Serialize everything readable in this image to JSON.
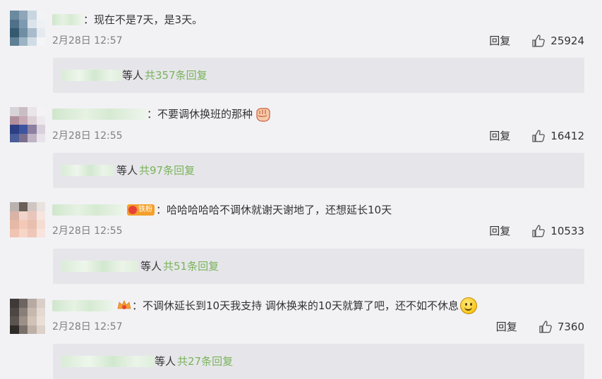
{
  "comments": [
    {
      "content": "：现在不是7天，是3天。",
      "timestamp": "2月28日 12:57",
      "reply_label": "回复",
      "likes": "25924",
      "replies_suffix": "等人",
      "replies_link": "共357条回复",
      "avatar_colors": [
        "#6b8aa0",
        "#8fa6b8",
        "#c9d6e0",
        "#f1f3f5",
        "#4e7088",
        "#7d9bb0",
        "#dbe4ea",
        "#eef1f4",
        "#35596f",
        "#6f8ea3",
        "#a9bccb",
        "#e4eaef",
        "#5f7f95",
        "#9cb3c3",
        "#d0dce5",
        "#f3f5f7"
      ]
    },
    {
      "content": "：不要调休换班的那种",
      "timestamp": "2月28日 12:55",
      "reply_label": "回复",
      "likes": "16412",
      "replies_suffix": "等人",
      "replies_link": "共97条回复",
      "avatar_colors": [
        "#d8d2d9",
        "#c9bec4",
        "#e9e5ea",
        "#f4f2f5",
        "#b08f9c",
        "#c7a9b5",
        "#dccfd6",
        "#eee9ec",
        "#2c3f82",
        "#3d54a0",
        "#8c7fa0",
        "#d9d0dc",
        "#4a5d9a",
        "#7c6f8e",
        "#bfb3c4",
        "#e8e3ea"
      ],
      "emoji": "fist-icon"
    },
    {
      "content": "：哈哈哈哈哈不调休就谢天谢地了，还想延长10天",
      "timestamp": "2月28日 12:55",
      "reply_label": "回复",
      "likes": "10533",
      "replies_suffix": "等人",
      "replies_link": "共51条回复",
      "badge_text": "铁粉",
      "avatar_colors": [
        "#b9b2ae",
        "#6b5f5a",
        "#cfc6c1",
        "#e9e2de",
        "#d8b3a6",
        "#f1d5cb",
        "#e9c6bb",
        "#f6e6df",
        "#e7b8a6",
        "#f3c9b8",
        "#e9c0b0",
        "#f5ddd3",
        "#f0c4b2",
        "#f7d5c7",
        "#efc7b8",
        "#f8e4dc"
      ]
    },
    {
      "content": "：不调休延长到10天我支持 调休换来的10天就算了吧，还不如不休息",
      "timestamp": "2月28日 12:57",
      "reply_label": "回复",
      "likes": "7360",
      "replies_suffix": "等人",
      "replies_link": "共27条回复",
      "avatar_colors": [
        "#3f3a37",
        "#6c6561",
        "#b7aaa2",
        "#d9cfc8",
        "#4d4743",
        "#8a7f78",
        "#c7b8ae",
        "#e3d9d2",
        "#5a534f",
        "#9c8f86",
        "#d1c2b7",
        "#eadfd7",
        "#2f2b29",
        "#7a706a",
        "#bfb0a6",
        "#ddd2ca"
      ],
      "emoji": "smile-face-icon"
    }
  ],
  "colors": {
    "background": "#f2f2f5",
    "reply_box": "#e6e6ea",
    "reply_link": "#7ab35b",
    "meta_text": "#808080"
  }
}
